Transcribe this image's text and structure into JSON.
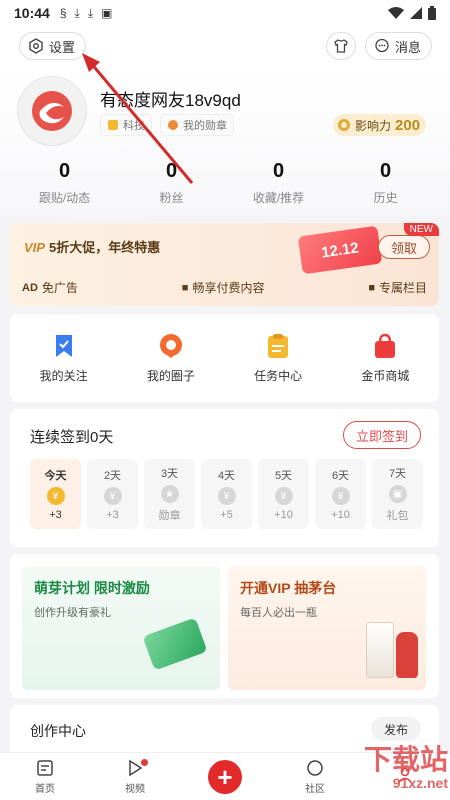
{
  "status_bar": {
    "time": "10:44",
    "indicators": [
      "sync",
      "download",
      "download",
      "A"
    ]
  },
  "top_bar": {
    "settings_label": "设置",
    "messages_label": "消息"
  },
  "profile": {
    "username": "有态度网友18v9qd",
    "badge_1": "科技",
    "badge_2": "我的勋章",
    "influence_label": "影响力",
    "influence_value": "200"
  },
  "stats": [
    {
      "value": "0",
      "label": "跟贴/动态"
    },
    {
      "value": "0",
      "label": "粉丝"
    },
    {
      "value": "0",
      "label": "收藏/推荐"
    },
    {
      "value": "0",
      "label": "历史"
    }
  ],
  "vip_banner": {
    "vip_tag": "VIP",
    "promo_text": "5折大促，年终特惠",
    "art_text": "12.12",
    "claim_label": "领取",
    "new_tag": "NEW",
    "perks": [
      {
        "icon": "AD",
        "label": "免广告"
      },
      {
        "icon": "■",
        "label": "畅享付费内容"
      },
      {
        "icon": "■",
        "label": "专属栏目"
      }
    ]
  },
  "quick_links": [
    {
      "label": "我的关注",
      "icon": "bookmark-icon",
      "color": "#3b7cf0"
    },
    {
      "label": "我的圈子",
      "icon": "circle-chat-icon",
      "color": "#f26a2e"
    },
    {
      "label": "任务中心",
      "icon": "task-clipboard-icon",
      "color": "#f5b82e"
    },
    {
      "label": "金币商城",
      "icon": "shopping-bag-icon",
      "color": "#ee3b3b"
    }
  ],
  "signin": {
    "title": "连续签到0天",
    "button_label": "立即签到",
    "days": [
      {
        "label": "今天",
        "reward": "+3",
        "coin": "¥"
      },
      {
        "label": "2天",
        "reward": "+3",
        "coin": "¥"
      },
      {
        "label": "3天",
        "reward": "勋章",
        "coin": "★"
      },
      {
        "label": "4天",
        "reward": "+5",
        "coin": "¥"
      },
      {
        "label": "5天",
        "reward": "+10",
        "coin": "¥"
      },
      {
        "label": "6天",
        "reward": "+10",
        "coin": "¥"
      },
      {
        "label": "7天",
        "reward": "礼包",
        "coin": "▣"
      }
    ]
  },
  "promos": {
    "left_title": "萌芽计划 限时激励",
    "left_sub": "创作升级有豪礼",
    "right_title": "开通VIP 抽茅台",
    "right_sub": "每百人必出一瓶"
  },
  "creation": {
    "title": "创作中心",
    "publish_label": "发布"
  },
  "tabbar": {
    "home": "首页",
    "video": "视频",
    "plus": "+",
    "community": "社区",
    "mine": ""
  },
  "watermark": {
    "text": "下载站",
    "site": "91xz.net"
  },
  "colors": {
    "accent_red": "#e32a2a",
    "influence_gold": "#b98a1c",
    "promo_green": "#1b8a45"
  }
}
